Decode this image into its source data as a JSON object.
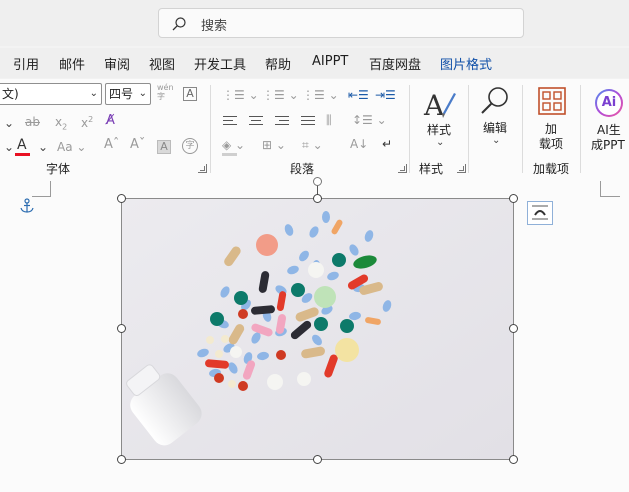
{
  "search": {
    "placeholder": "搜索",
    "icon": "search-icon"
  },
  "tabs": [
    "引用",
    "邮件",
    "审阅",
    "视图",
    "开发工具",
    "帮助",
    "AIPPT",
    "百度网盘",
    "图片格式"
  ],
  "active_tab": "图片格式",
  "font": {
    "name_value": "文)",
    "size_value": "四号",
    "wen_label": "wén",
    "group_label": "字体",
    "font_color": "#e81123",
    "ab_label": "ab",
    "x2_label": "x",
    "subscript_label": "2",
    "aa_label": "Aa",
    "grow_label": "A",
    "shrink_label": "A",
    "clear_label": "A",
    "char_border_label": "A",
    "phonetic_label": "字"
  },
  "paragraph": {
    "group_label": "段落"
  },
  "styles": {
    "button_label": "样式",
    "group_label": "样式"
  },
  "editing": {
    "button_label": "编辑"
  },
  "addins": {
    "button_label_line1": "加",
    "button_label_line2": "载项",
    "group_label": "加载项"
  },
  "ai": {
    "icon_text": "Ai",
    "button_label_line1": "AI生",
    "button_label_line2": "成PPT"
  },
  "document": {
    "image_alt": "colorful pills and capsules spilling from a white bottle"
  }
}
